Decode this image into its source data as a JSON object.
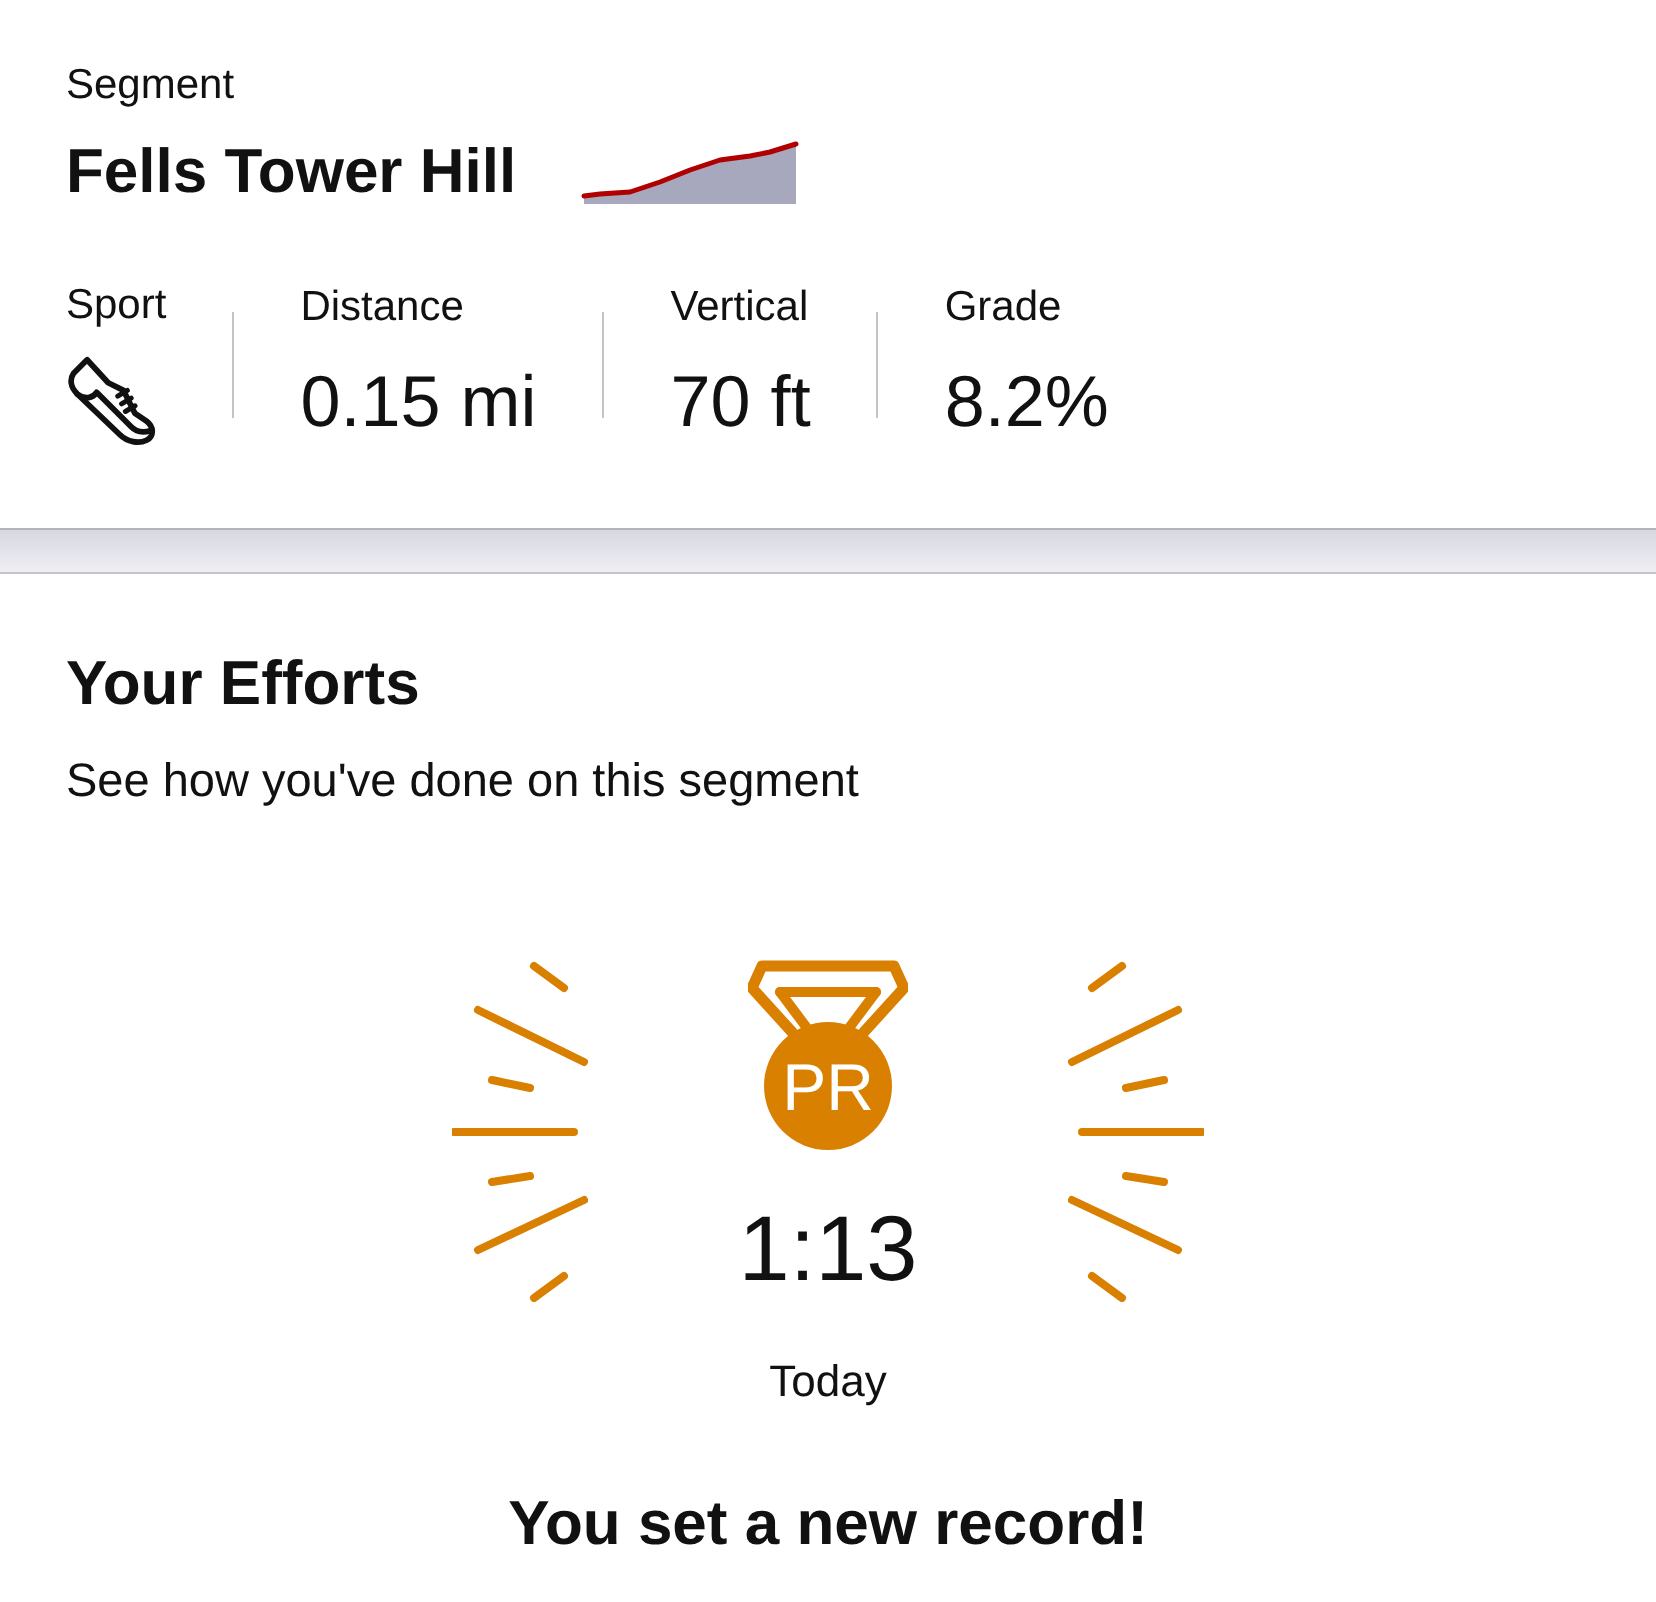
{
  "header": {
    "label": "Segment",
    "title": "Fells Tower Hill"
  },
  "stats": [
    {
      "label": "Sport",
      "kind": "icon"
    },
    {
      "label": "Distance",
      "kind": "value",
      "value": "0.15 mi"
    },
    {
      "label": "Vertical",
      "kind": "value",
      "value": "70 ft"
    },
    {
      "label": "Grade",
      "kind": "value",
      "value": "8.2%"
    }
  ],
  "efforts": {
    "title": "Your Efforts",
    "subtitle": "See how you've done on this segment",
    "badge": "PR",
    "time": "1:13",
    "date": "Today",
    "message": "You set a new record!"
  }
}
